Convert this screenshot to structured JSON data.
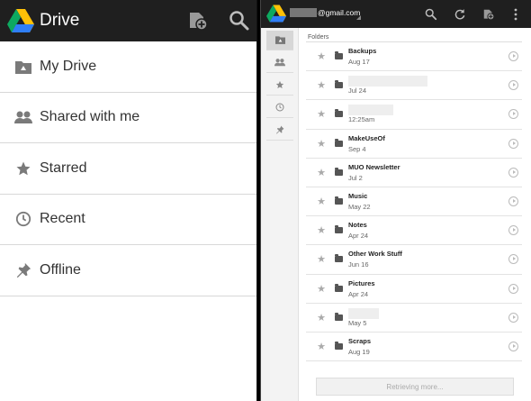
{
  "left_panel": {
    "app_title": "Drive",
    "icons": {
      "logo": "drive-logo-icon",
      "upload": "upload-icon",
      "search": "search-icon"
    },
    "nav": [
      {
        "label": "My Drive",
        "icon": "my-drive-icon"
      },
      {
        "label": "Shared with me",
        "icon": "people-icon"
      },
      {
        "label": "Starred",
        "icon": "star-icon"
      },
      {
        "label": "Recent",
        "icon": "clock-icon"
      },
      {
        "label": "Offline",
        "icon": "pin-icon"
      }
    ]
  },
  "right_panel": {
    "account_email": "@gmail.com",
    "icons": {
      "logo": "drive-logo-icon",
      "search": "search-icon",
      "refresh": "refresh-icon",
      "upload": "upload-icon",
      "overflow": "overflow-menu-icon"
    },
    "rail": [
      "my-drive-icon",
      "people-icon",
      "star-icon",
      "clock-icon",
      "pin-icon"
    ],
    "section_label": "Folders",
    "folders": [
      {
        "name": "Backups",
        "date": "Aug 17"
      },
      {
        "name": "",
        "date": "Jul 24"
      },
      {
        "name": "",
        "date": "12:25am"
      },
      {
        "name": "MakeUseOf",
        "date": "Sep 4"
      },
      {
        "name": "MUO Newsletter",
        "date": "Jul 2"
      },
      {
        "name": "Music",
        "date": "May 22"
      },
      {
        "name": "Notes",
        "date": "Apr 24"
      },
      {
        "name": "Other Work Stuff",
        "date": "Jun 16"
      },
      {
        "name": "Pictures",
        "date": "Apr 24"
      },
      {
        "name": "",
        "date": "May 5"
      },
      {
        "name": "Scraps",
        "date": "Aug 19"
      }
    ],
    "retrieving_label": "Retrieving more..."
  },
  "colors": {
    "topbar": "#1f1f1f",
    "drive_green": "#0da960",
    "drive_yellow": "#ffc107",
    "drive_blue": "#2f7ef6"
  }
}
